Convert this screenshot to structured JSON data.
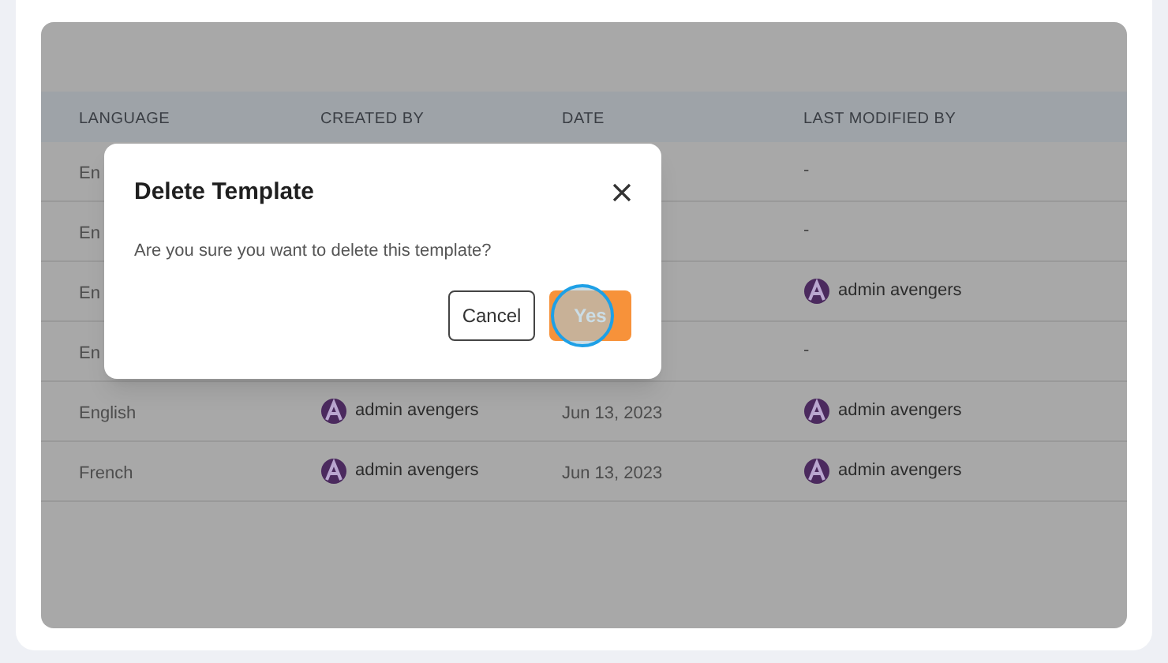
{
  "table": {
    "columns": [
      "LANGUAGE",
      "CREATED BY",
      "DATE",
      "LAST MODIFIED BY"
    ],
    "rows": [
      {
        "language": "En",
        "last_modified_by": {
          "kind": "plain",
          "text": "-"
        }
      },
      {
        "language": "En",
        "last_modified_by": {
          "kind": "plain",
          "text": "-"
        }
      },
      {
        "language": "En",
        "last_modified_by": {
          "kind": "user",
          "text": "admin avengers"
        }
      },
      {
        "language": "En",
        "last_modified_by": {
          "kind": "plain",
          "text": "-"
        }
      },
      {
        "language": "English",
        "created_by": {
          "kind": "user",
          "text": "admin avengers"
        },
        "date": "Jun 13, 2023",
        "last_modified_by": {
          "kind": "user",
          "text": "admin avengers"
        }
      },
      {
        "language": "French",
        "created_by": {
          "kind": "user",
          "text": "admin avengers"
        },
        "date": "Jun 13, 2023",
        "last_modified_by": {
          "kind": "user",
          "text": "admin avengers"
        }
      }
    ]
  },
  "dialog": {
    "title": "Delete Template",
    "message": "Are you sure you want to delete this template?",
    "buttons": [
      {
        "label": "Cancel",
        "kind": "outline",
        "pressed": false
      },
      {
        "label": "Yes",
        "kind": "primary",
        "pressed": true
      }
    ]
  }
}
